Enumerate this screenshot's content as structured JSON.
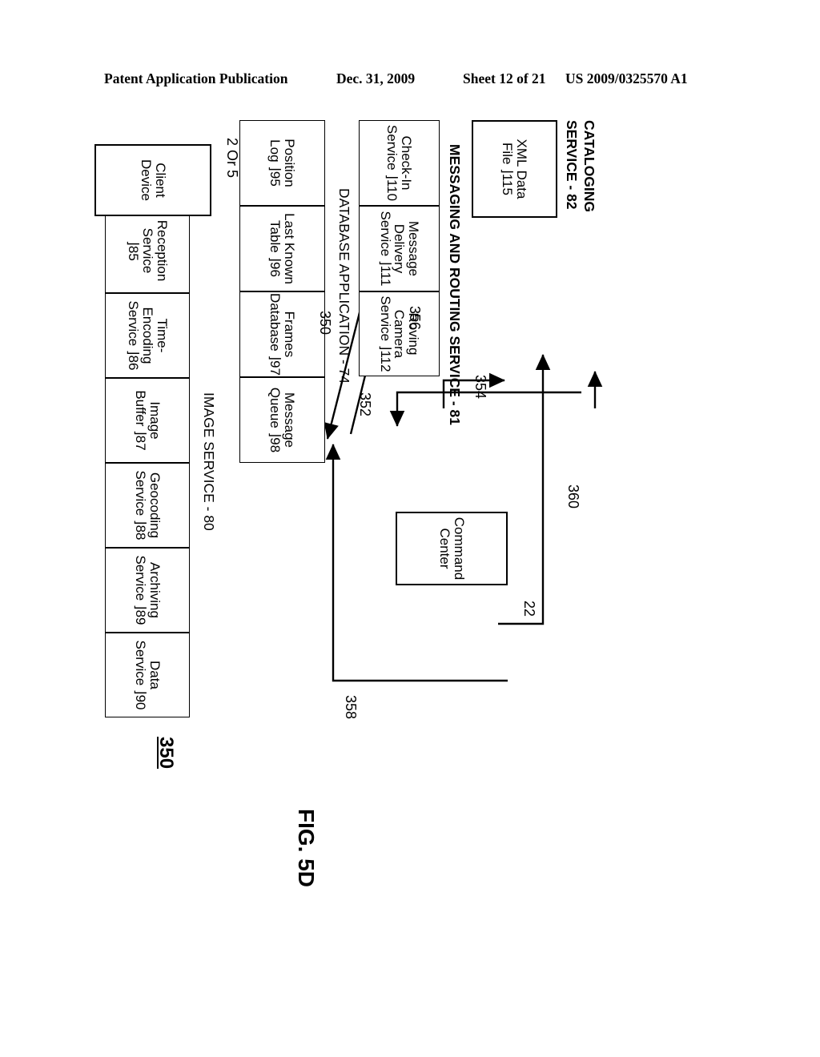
{
  "header": {
    "publication": "Patent Application Publication",
    "date": "Dec. 31, 2009",
    "sheet": "Sheet 12 of 21",
    "patent_number": "US 2009/0325570 A1"
  },
  "figure": {
    "label": "FIG. 5D",
    "number": "350"
  },
  "groups": {
    "image_service": {
      "title": "IMAGE SERVICE - 80",
      "cells": [
        {
          "line1": "Reception",
          "line2": "Service",
          "ref": "85"
        },
        {
          "line1": "Time-",
          "line2": "Encoding",
          "line3": "Service",
          "ref": "86"
        },
        {
          "line1": "Image",
          "line2": "Buffer",
          "ref": "87"
        },
        {
          "line1": "Geocoding",
          "line2": "Service",
          "ref": "88"
        },
        {
          "line1": "Archiving",
          "line2": "Service",
          "ref": "89"
        },
        {
          "line1": "Data",
          "line2": "Service",
          "ref": "90"
        }
      ]
    },
    "database_application": {
      "title": "DATABASE APPLICATION - 74",
      "cells": [
        {
          "line1": "Position",
          "line2": "Log",
          "ref": "95"
        },
        {
          "line1": "Last Known",
          "line2": "Table",
          "ref": "96"
        },
        {
          "line1": "Frames",
          "line2": "Database",
          "ref": "97"
        },
        {
          "line1": "Message",
          "line2": "Queue",
          "ref": "98"
        }
      ]
    },
    "messaging_routing": {
      "title": "MESSAGING AND ROUTING SERVICE - 81",
      "cells": [
        {
          "line1": "Check-In",
          "line2": "Service",
          "ref": "110"
        },
        {
          "line1": "Message",
          "line2": "Delivery",
          "line3": "Service",
          "ref": "111"
        },
        {
          "line1": "Roving",
          "line2": "Camera",
          "line3": "Service",
          "ref": "112"
        }
      ]
    },
    "cataloging_service": {
      "title_line1": "CATALOGING",
      "title_line2": "SERVICE - 82",
      "cells": [
        {
          "line1": "XML Data",
          "line2": "File",
          "ref": "115"
        }
      ]
    }
  },
  "nodes": {
    "command_center": {
      "line1": "Command",
      "line2": "Center",
      "ref": "22"
    },
    "client_device": {
      "line1": "Client",
      "line2": "Device",
      "ref": "2 Or 5"
    }
  },
  "connectors": [
    {
      "id": "350",
      "label": "350"
    },
    {
      "id": "352",
      "label": "352"
    },
    {
      "id": "354",
      "label": "354"
    },
    {
      "id": "356",
      "label": "356"
    },
    {
      "id": "358",
      "label": "358"
    },
    {
      "id": "360",
      "label": "360"
    }
  ]
}
